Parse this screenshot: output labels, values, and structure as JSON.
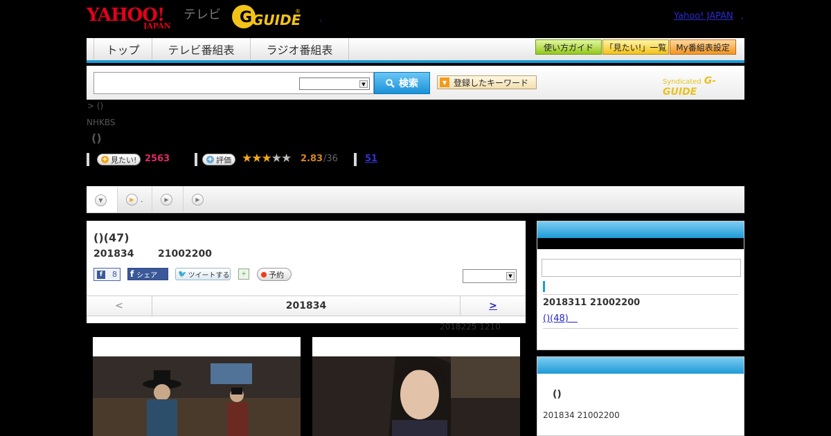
{
  "header": {
    "yahoo_logo": "YAHOO! JAPAN",
    "tv_label": "テレビ",
    "gguide_logo": "G-GUIDE",
    "dot_left": ",",
    "yahoo_japan_link": "Yahoo! JAPAN",
    "dot_right": ","
  },
  "nav": {
    "tabs": [
      "トップ",
      "テレビ番組表",
      "ラジオ番組表"
    ],
    "guide_btn": "使い方ガイド",
    "mitai_list_btn": "「見たい!」一覧",
    "my_schedule_btn": "My番組表設定"
  },
  "search": {
    "input_value": "",
    "select_value": "",
    "button_label": "検索",
    "keyword_btn": "登録したキーワード",
    "syndicated_label": "Syndicated",
    "syndicated_logo": "G-GUIDE"
  },
  "breadcrumb": ">  ()",
  "station": "NHKBS",
  "program_title": "()",
  "ratings": {
    "mitai_btn": "見たい!",
    "mitai_count": "2563",
    "hyoka_btn": "評価",
    "stars": "★★★★★",
    "rating_value": "2.83",
    "rating_count": "/36",
    "review_count": "51"
  },
  "tabs": [
    "",
    ".",
    "",
    ""
  ],
  "episode": {
    "title": "()(47)",
    "date": "201834",
    "time": "21002200",
    "fb_like_count": "8",
    "fb_share": "シェア",
    "tweet": "ツイートする",
    "reserve": "予約",
    "select_value": "",
    "prev": "<",
    "nav_date": "201834",
    "next": ">",
    "updated": "2018225  1210"
  },
  "sidebar": {
    "box1_date": "201831‌1  21002200",
    "box1_link": "()(48)　",
    "box2_title": "()",
    "box2_date": "201834  21002200"
  },
  "colors": {
    "accent_blue": "#1f9ad6",
    "pink_count": "#e02868",
    "rating_orange": "#d88820"
  }
}
